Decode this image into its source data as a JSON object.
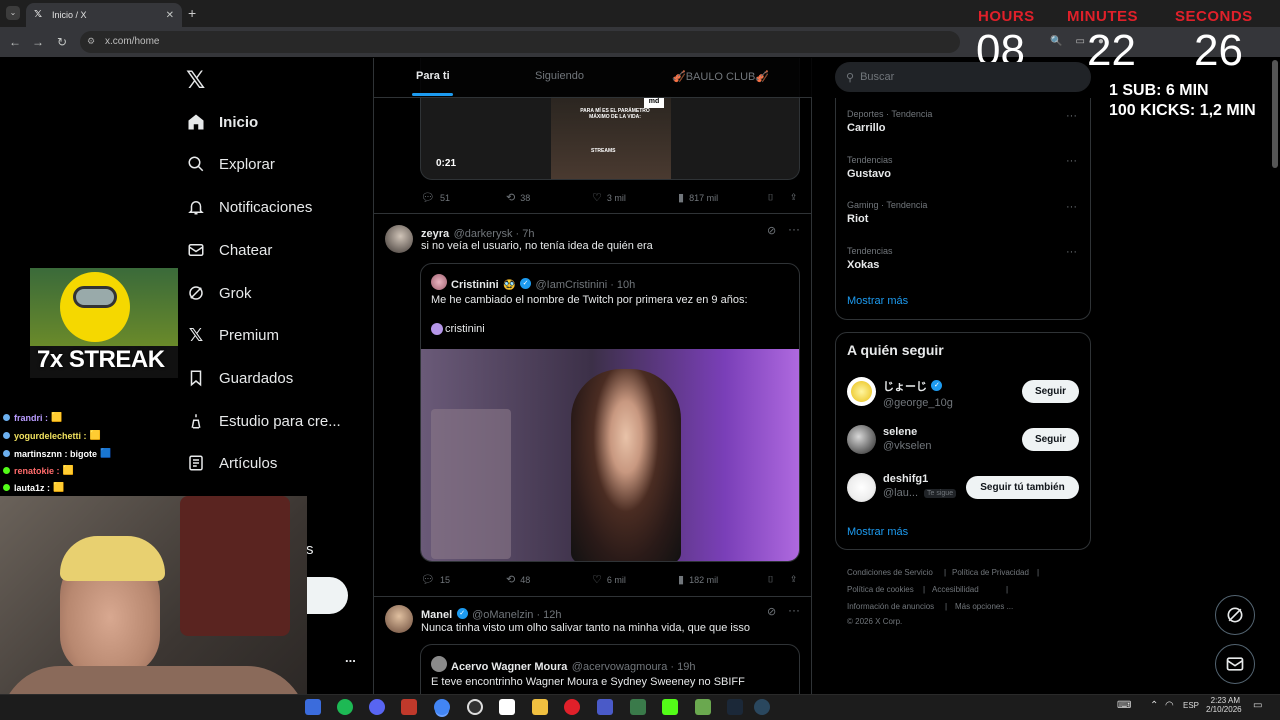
{
  "browser": {
    "tab_title": "Inicio / X",
    "tab_close": "✕",
    "new_tab": "+",
    "url": "x.com/home"
  },
  "timer": {
    "labels": [
      "HOURS",
      "MINUTES",
      "SECONDS"
    ],
    "values": [
      "08",
      "22",
      "26"
    ],
    "rule1": "1 SUB: 6 MIN",
    "rule2": "100 KICKS: 1,2 MIN"
  },
  "nav": {
    "items": [
      {
        "label": "Inicio",
        "icon": "home-icon"
      },
      {
        "label": "Explorar",
        "icon": "search-icon"
      },
      {
        "label": "Notificaciones",
        "icon": "bell-icon"
      },
      {
        "label": "Chatear",
        "icon": "mail-icon"
      },
      {
        "label": "Grok",
        "icon": "grok-icon"
      },
      {
        "label": "Premium",
        "icon": "x-logo-icon"
      },
      {
        "label": "Guardados",
        "icon": "bookmark-icon"
      },
      {
        "label": "Estudio para cre...",
        "icon": "creator-icon"
      },
      {
        "label": "Artículos",
        "icon": "article-icon"
      }
    ],
    "partial_letter": "s",
    "more_dots": "..."
  },
  "timeline": {
    "tabs": [
      "Para ti",
      "Siguiendo",
      "🎻BAULO CLUB🎻"
    ],
    "post1": {
      "video_duration": "0:21",
      "video_caption": "PARA MÍ ES EL PARÁMETRO MÁXIMO DE LA VIDA:",
      "video_text": "STREAMS",
      "replies": "51",
      "reposts": "38",
      "likes": "3 mil",
      "views": "817 mil"
    },
    "post2": {
      "name": "zeyra",
      "handle": "@darkerysk · 7h",
      "text": "si no veía el usuario, no tenía idea de quién era",
      "quote_name": "Cristinini",
      "quote_handle": "@IamCristinini · 10h",
      "quote_text": "Me he cambiado el nombre de Twitch por primera vez en 9 años:",
      "quote_sub": "cristinini",
      "replies": "15",
      "reposts": "48",
      "likes": "6 mil",
      "views": "182 mil"
    },
    "post3": {
      "name": "Manel",
      "handle": "@oManelzin · 12h",
      "text": "Nunca tinha visto um olho salivar tanto na minha vida, que que isso",
      "quote_name": "Acervo Wagner Moura",
      "quote_handle": "@acervowagmoura · 19h",
      "quote_text": "E teve encontrinho Wagner Moura e Sydney Sweeney no SBIFF"
    }
  },
  "sidebar": {
    "search_placeholder": "Buscar",
    "trends": [
      {
        "category": "Deportes · Tendencia",
        "name": "Carrillo"
      },
      {
        "category": "Tendencias",
        "name": "Gustavo"
      },
      {
        "category": "Gaming · Tendencia",
        "name": "Riot"
      },
      {
        "category": "Tendencias",
        "name": "Xokas"
      }
    ],
    "show_more": "Mostrar más",
    "who_to_follow_title": "A quién seguir",
    "follows": [
      {
        "name": "じょーじ",
        "handle": "@george_10g",
        "button": "Seguir",
        "follows_you": ""
      },
      {
        "name": "selene ⠀",
        "handle": "@vkselen",
        "button": "Seguir",
        "follows_you": ""
      },
      {
        "name": "deshifg1",
        "handle": "@lau...",
        "button": "Seguir tú también",
        "follows_you": "Te sigue"
      }
    ],
    "show_more_2": "Mostrar más",
    "footer": [
      "Condiciones de Servicio",
      "Política de Privacidad",
      "Política de cookies",
      "Accesibilidad",
      "Información de anuncios",
      "Más opciones ...",
      "© 2026 X Corp."
    ]
  },
  "stream": {
    "streak": "7x STREAK",
    "chat": [
      {
        "user": "frandri :",
        "color": "#9147ff"
      },
      {
        "user": "yogurdelechetti :",
        "color": "#f1c40f"
      },
      {
        "user": "martinsznn : bigote",
        "color": "#e0e0e0"
      },
      {
        "user": "renatokie :",
        "color": "#ff5a5a"
      },
      {
        "user": "lauta1z :",
        "color": "#53fc18"
      }
    ]
  },
  "taskbar": {
    "lang": "ESP",
    "time": "2:23 AM",
    "date": "2/10/2026"
  }
}
